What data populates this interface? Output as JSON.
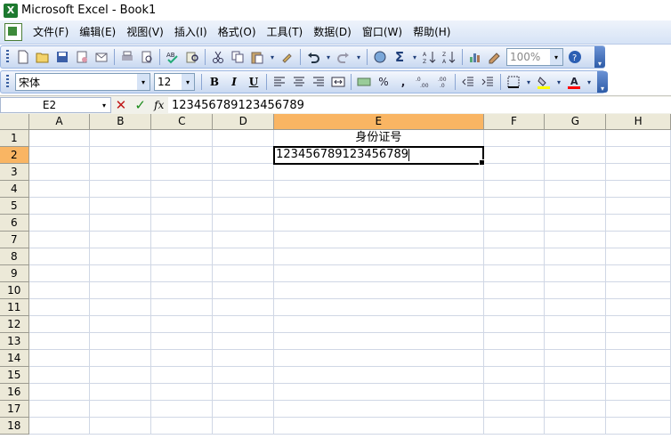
{
  "window": {
    "title": "Microsoft Excel - Book1"
  },
  "menu": {
    "items": [
      "文件(F)",
      "编辑(E)",
      "视图(V)",
      "插入(I)",
      "格式(O)",
      "工具(T)",
      "数据(D)",
      "窗口(W)",
      "帮助(H)"
    ]
  },
  "toolbar": {
    "zoom_value": "100%",
    "autosum_glyph": "Σ"
  },
  "format_toolbar": {
    "font_name": "宋体",
    "font_size": "12",
    "bold_label": "B",
    "italic_label": "I",
    "underline_label": "U",
    "percent_label": "%",
    "comma_label": ",",
    "fill_color": "#ffff00",
    "font_color": "#ff0000"
  },
  "formula_bar": {
    "name_box": "E2",
    "fx_label": "fx",
    "value": "123456789123456789"
  },
  "sheet": {
    "columns": [
      "A",
      "B",
      "C",
      "D",
      "E",
      "F",
      "G",
      "H"
    ],
    "active_column": "E",
    "active_row": "2",
    "rows": [
      "1",
      "2",
      "3",
      "4",
      "5",
      "6",
      "7",
      "8",
      "9",
      "10",
      "11",
      "12",
      "13",
      "14",
      "15",
      "16",
      "17",
      "18"
    ],
    "cells": {
      "E1": "身份证号",
      "E2": "123456789123456789"
    }
  }
}
